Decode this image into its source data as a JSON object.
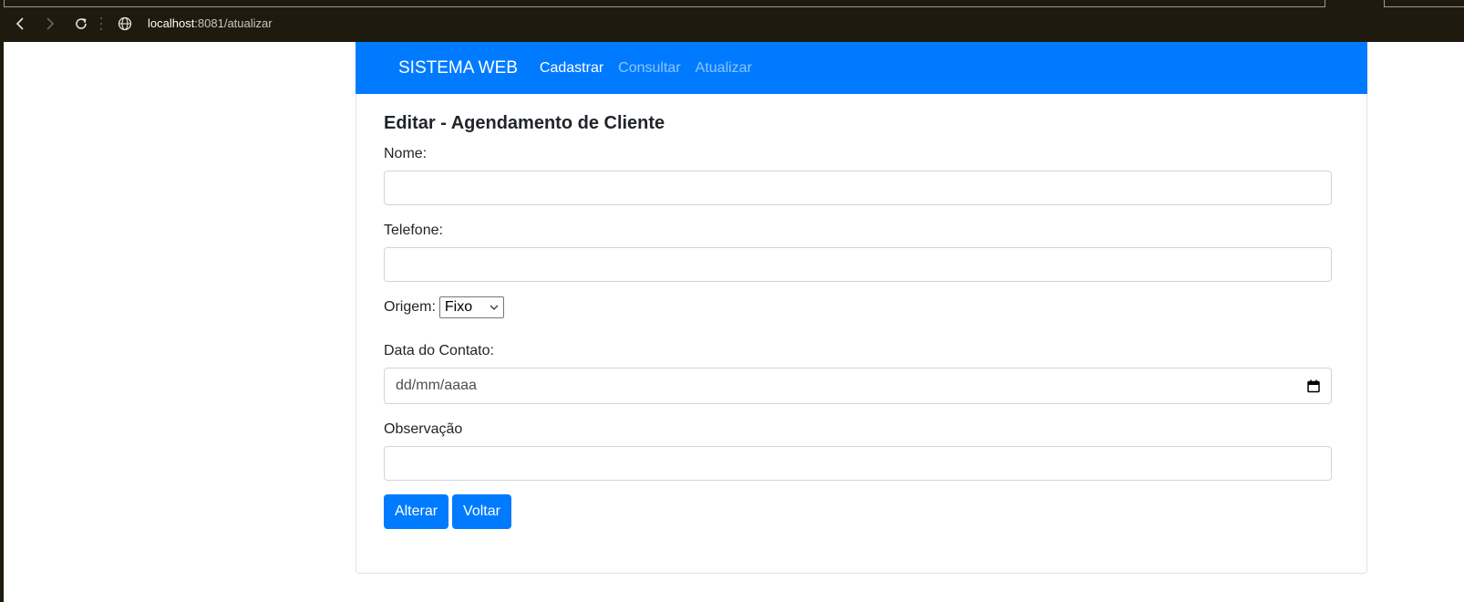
{
  "browser": {
    "url_host": "localhost",
    "url_rest": ":8081/atualizar",
    "back_icon": "chevron-left-icon",
    "forward_icon": "chevron-right-icon",
    "reload_icon": "reload-icon",
    "site_icon": "globe-icon"
  },
  "navbar": {
    "brand": "SISTEMA WEB",
    "links": [
      {
        "label": "Cadastrar",
        "active": true
      },
      {
        "label": "Consultar",
        "active": false
      },
      {
        "label": "Atualizar",
        "active": false
      }
    ],
    "color": "#007bff"
  },
  "form": {
    "title": "Editar - Agendamento de Cliente",
    "nome_label": "Nome:",
    "nome_value": "",
    "telefone_label": "Telefone:",
    "telefone_value": "",
    "origem_label": "Origem:",
    "origem_selected": "Fixo",
    "data_label": "Data do Contato:",
    "data_placeholder": "dd/mm/aaaa",
    "observacao_label": "Observação",
    "observacao_value": "",
    "alterar_button": "Alterar",
    "voltar_button": "Voltar"
  }
}
